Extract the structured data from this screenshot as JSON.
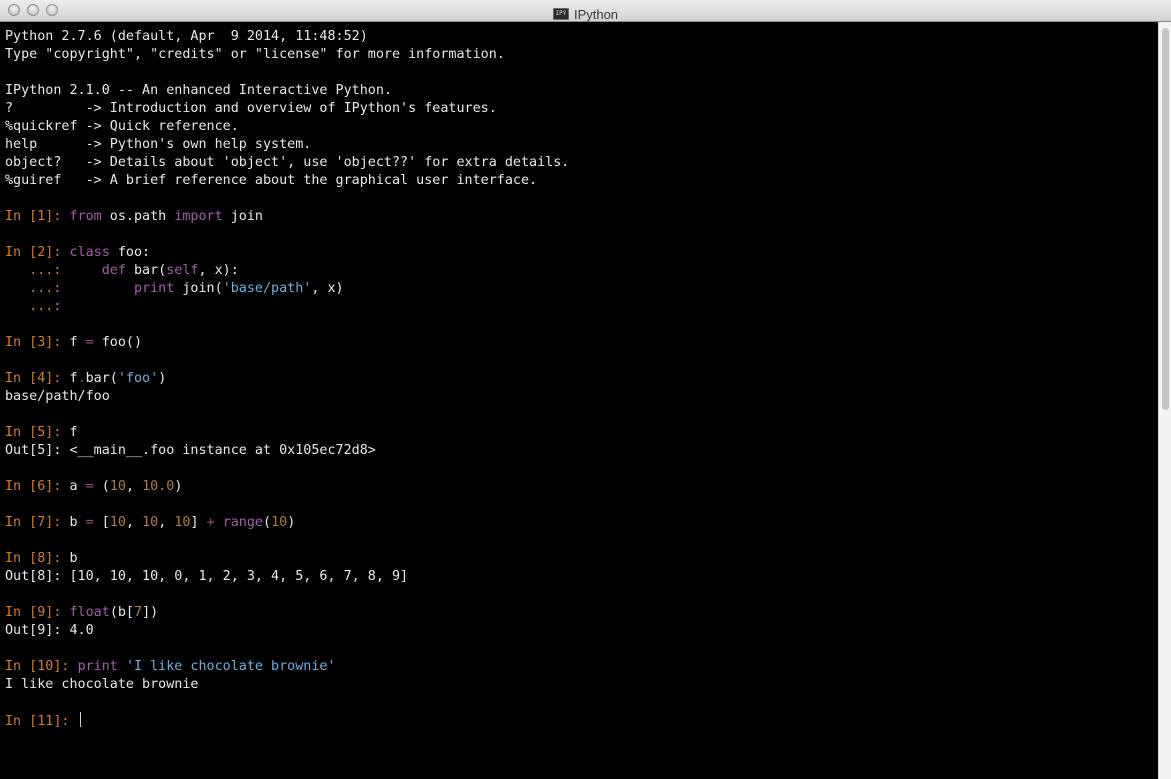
{
  "window": {
    "title": "IPython",
    "app_icon_text": "IPY"
  },
  "banner": {
    "line1": "Python 2.7.6 (default, Apr  9 2014, 11:48:52)",
    "line2": "Type \"copyright\", \"credits\" or \"license\" for more information.",
    "line3": "IPython 2.1.0 -- An enhanced Interactive Python.",
    "help_lines": [
      "?         -> Introduction and overview of IPython's features.",
      "%quickref -> Quick reference.",
      "help      -> Python's own help system.",
      "object?   -> Details about 'object', use 'object??' for extra details.",
      "%guiref   -> A brief reference about the graphical user interface."
    ]
  },
  "session": {
    "in1": {
      "prompt": "In [1]: ",
      "kw1": "from",
      "mod": " os.path ",
      "kw2": "import",
      "name": " join"
    },
    "in2": {
      "prompt": "In [2]: ",
      "kw": "class",
      "rest": " foo:",
      "cont_prompt": "   ...: ",
      "l2_indent": "    ",
      "l2_kw": "def",
      "l2_a": " bar(",
      "l2_self": "self",
      "l2_b": ", x):",
      "l3_indent": "        ",
      "l3_kw": "print",
      "l3_a": " join(",
      "l3_str": "'base/path'",
      "l3_b": ", x)"
    },
    "in3": {
      "prompt": "In [3]: ",
      "a": "f ",
      "op": "=",
      "b": " foo()"
    },
    "in4": {
      "prompt": "In [4]: ",
      "a": "f",
      "op": ".",
      "b": "bar(",
      "str": "'foo'",
      "c": ")",
      "output": "base/path/foo"
    },
    "in5": {
      "prompt": "In [5]: ",
      "code": "f",
      "out_prompt": "Out[5]: ",
      "output": "<__main__.foo instance at 0x105ec72d8>"
    },
    "in6": {
      "prompt": "In [6]: ",
      "a": "a ",
      "op": "=",
      "b": " (",
      "n1": "10",
      "c": ", ",
      "n2": "10.0",
      "d": ")"
    },
    "in7": {
      "prompt": "In [7]: ",
      "a": "b ",
      "op": "=",
      "b": " [",
      "n1": "10",
      "c": ", ",
      "n2": "10",
      "d": ", ",
      "n3": "10",
      "e": "] ",
      "op2": "+",
      "f": " ",
      "func": "range",
      "g": "(",
      "n4": "10",
      "h": ")"
    },
    "in8": {
      "prompt": "In [8]: ",
      "code": "b",
      "out_prompt": "Out[8]: ",
      "output": "[10, 10, 10, 0, 1, 2, 3, 4, 5, 6, 7, 8, 9]"
    },
    "in9": {
      "prompt": "In [9]: ",
      "func": "float",
      "a": "(b[",
      "n": "7",
      "b": "])",
      "out_prompt": "Out[9]: ",
      "output": "4.0"
    },
    "in10": {
      "prompt": "In [10]: ",
      "kw": "print",
      "sp": " ",
      "str": "'I like chocolate brownie'",
      "output": "I like chocolate brownie"
    },
    "in11": {
      "prompt": "In [11]: "
    }
  }
}
